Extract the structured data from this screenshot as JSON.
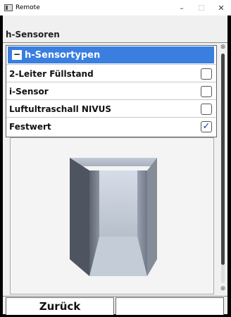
{
  "window": {
    "title": "Remote",
    "minimize_icon": "minimize-icon",
    "maximize_icon": "maximize-icon",
    "close_icon": "close-icon"
  },
  "screen": {
    "section_title": "h-Sensoren",
    "list": {
      "header_label": "h-Sensortypen",
      "header_color": "#3a7ee0",
      "items": [
        {
          "label": "2-Leiter Füllstand",
          "checked": false
        },
        {
          "label": "i-Sensor",
          "checked": false
        },
        {
          "label": "Luftultraschall NIVUS",
          "checked": false
        },
        {
          "label": "Festwert",
          "checked": true
        }
      ]
    },
    "footer": {
      "back_label": "Zurück",
      "right_label": ""
    }
  }
}
